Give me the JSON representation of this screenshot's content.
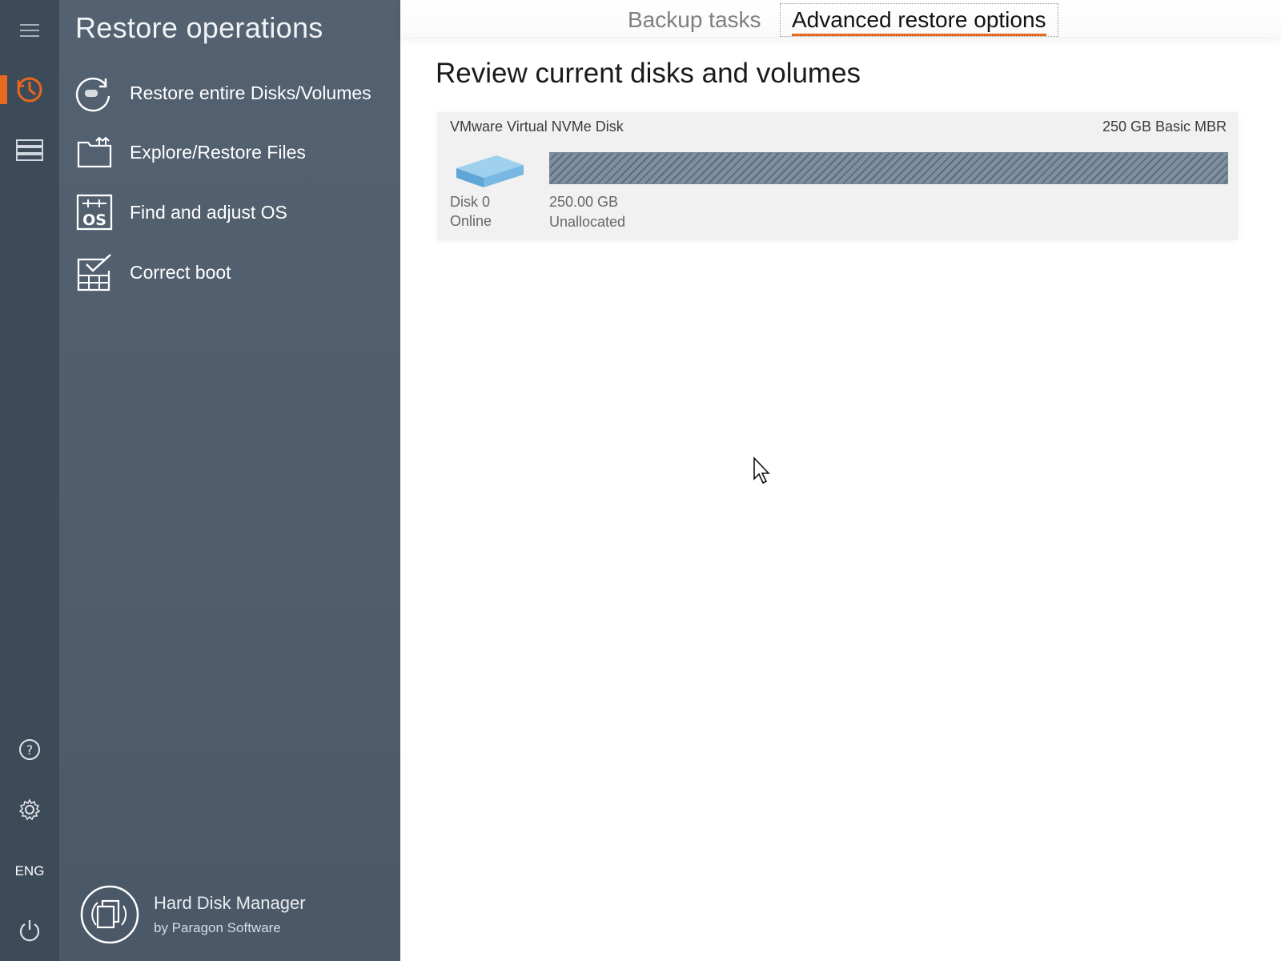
{
  "rail": {
    "language": "ENG",
    "accent_color": "#e8681f",
    "icons": [
      "menu-icon",
      "restore-clock-icon",
      "disks-icon",
      "help-icon",
      "gear-icon",
      "power-icon"
    ]
  },
  "panel": {
    "title": "Restore operations",
    "items": [
      {
        "label": "Restore entire Disks/Volumes",
        "icon": "restore-disk-icon"
      },
      {
        "label": "Explore/Restore Files",
        "icon": "explore-files-icon"
      },
      {
        "label": "Find and adjust OS",
        "icon": "os-icon"
      },
      {
        "label": "Correct boot",
        "icon": "correct-boot-icon"
      }
    ],
    "brand": {
      "name": "Hard Disk Manager",
      "by": "by Paragon Software"
    }
  },
  "main": {
    "tabs": [
      {
        "label": "Backup tasks",
        "active": false
      },
      {
        "label": "Advanced restore options",
        "active": true
      }
    ],
    "section_title": "Review current disks and volumes",
    "disk": {
      "name": "VMware Virtual NVMe Disk",
      "info": "250 GB Basic MBR",
      "label": "Disk 0",
      "status": "Online",
      "volume": {
        "size": "250.00 GB",
        "type": "Unallocated"
      }
    }
  }
}
